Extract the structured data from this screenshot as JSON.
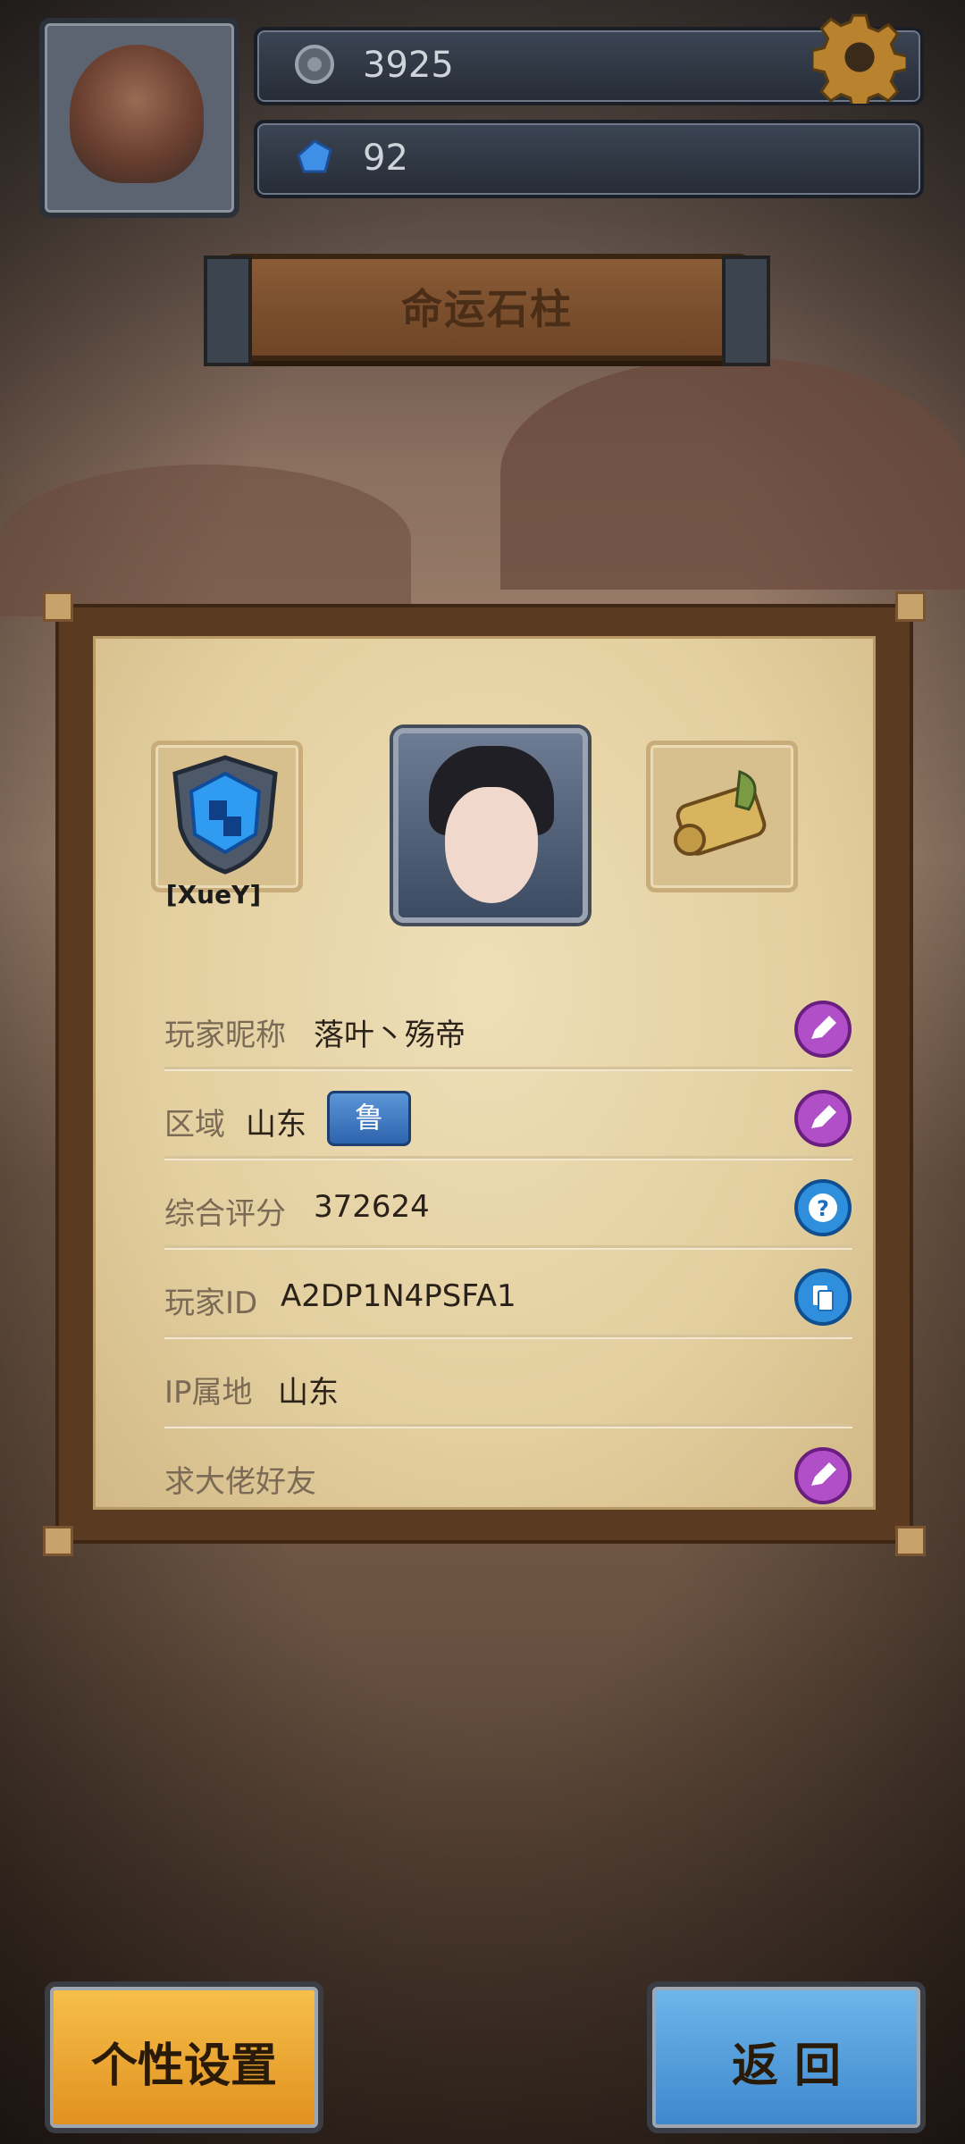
{
  "currencies": [
    {
      "icon": "silver-coin-icon",
      "value": "3925"
    },
    {
      "icon": "blue-gem-icon",
      "value": "92"
    }
  ],
  "settings_icon": "gear-icon",
  "title": "命运石柱",
  "guild_tag": "[XueY]",
  "rows": [
    {
      "label": "玩家昵称",
      "value": "落叶丶殇帝",
      "action": "edit"
    },
    {
      "label": "区域",
      "value": "山东",
      "tag": "鲁",
      "action": "edit"
    },
    {
      "label": "综合评分",
      "value": "372624",
      "action": "help"
    },
    {
      "label": "玩家ID",
      "value": "A2DP1N4PSFA1",
      "action": "copy"
    },
    {
      "label": "IP属地",
      "value": "山东"
    },
    {
      "label": "求大佬好友",
      "value": "",
      "action": "edit"
    }
  ],
  "buttons": {
    "left": "个性设置",
    "right": "返 回"
  },
  "colors": {
    "seal_purple": "#b04fc7",
    "seal_blue": "#2f8fdc",
    "btn_orange": "#f2a534",
    "btn_blue": "#4f9fdc"
  }
}
